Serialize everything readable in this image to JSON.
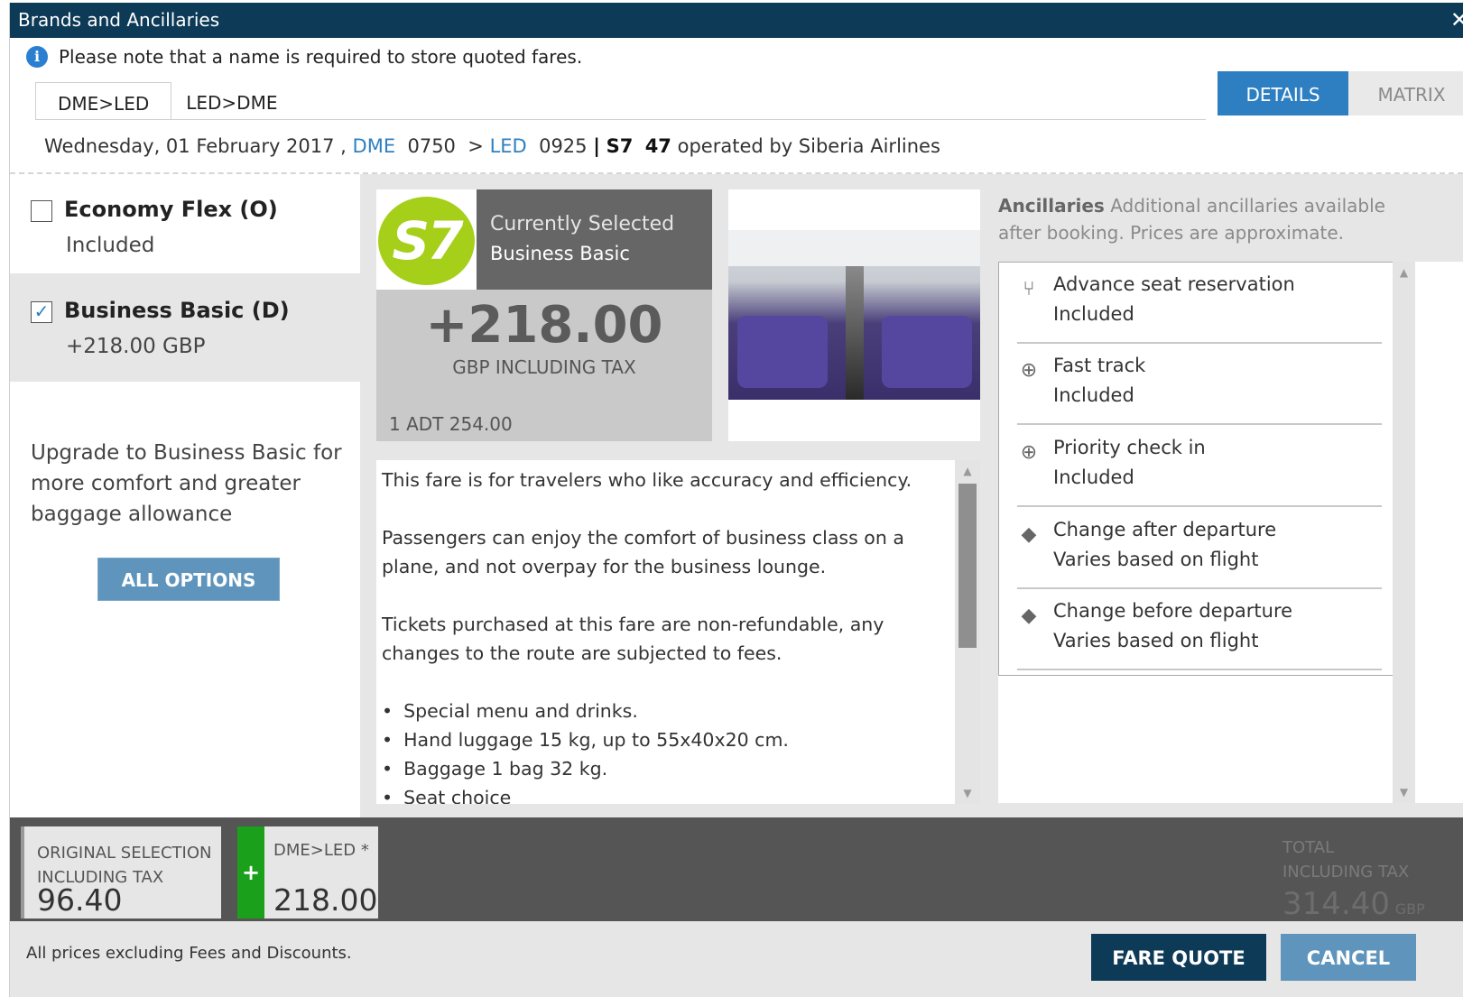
{
  "window": {
    "title": "Brands and Ancillaries",
    "close_glyph": "✕"
  },
  "notice": {
    "icon": "info-icon",
    "text": "Please note that a name is required to store quoted fares."
  },
  "tabs": [
    {
      "label": "DME>LED",
      "active": true
    },
    {
      "label": "LED>DME",
      "active": false
    }
  ],
  "view_switch": {
    "details": "DETAILS",
    "matrix": "MATRIX",
    "active": "DETAILS"
  },
  "flight": {
    "date": "Wednesday, 01 February 2017 ,",
    "origin": "DME",
    "dep_time": "0750",
    "arrow": ">",
    "destination": "LED",
    "arr_time": "0925",
    "separator": "|",
    "carrier": "S7",
    "number": "47",
    "operated_by": "operated by Siberia Airlines"
  },
  "brands": [
    {
      "name": "Economy Flex (O)",
      "price": "Included",
      "checked": false
    },
    {
      "name": "Business Basic (D)",
      "price": "+218.00  GBP",
      "checked": true
    }
  ],
  "upgrade_text": "Upgrade to Business Basic for more comfort and greater baggage allowance",
  "all_options_label": "ALL OPTIONS",
  "selected": {
    "logo_text": "S7",
    "currently_selected": "Currently Selected",
    "brand": "Business Basic",
    "price": "+218.00",
    "price_note": "GBP INCLUDING TAX",
    "adt": "1 ADT 254.00"
  },
  "description": {
    "paragraphs": [
      "This fare is for travelers who like accuracy and efficiency.",
      "Passengers can enjoy the comfort of business class on a plane, and not overpay for the business lounge.",
      "Tickets purchased at this fare are non-refundable, any changes to the route are subjected to fees."
    ],
    "bullets": [
      "Special menu and drinks.",
      "Hand luggage 15 kg, up to 55x40x20 cm.",
      "Baggage 1 bag 32 kg.",
      "Seat choice"
    ]
  },
  "ancillaries": {
    "title": "Ancillaries",
    "subtitle": "Additional ancillaries available after booking. Prices are approximate.",
    "items": [
      {
        "icon": "seat-icon",
        "name": "Advance seat reservation",
        "status": "Included"
      },
      {
        "icon": "globe-icon",
        "name": "Fast track",
        "status": "Included"
      },
      {
        "icon": "globe-icon",
        "name": "Priority check in",
        "status": "Included"
      },
      {
        "icon": "tag-icon",
        "name": "Change after departure",
        "status": "Varies based on flight"
      },
      {
        "icon": "tag-icon",
        "name": "Change before departure",
        "status": "Varies based on flight"
      }
    ]
  },
  "summary": {
    "original_label": "ORIGINAL SELECTION INCLUDING TAX",
    "original_value": "96.40",
    "plus": "+",
    "leg_label": "DME>LED *",
    "leg_value": "218.00",
    "total_label_1": "TOTAL",
    "total_label_2": "INCLUDING TAX",
    "total_value": "314.40",
    "total_currency": "GBP"
  },
  "footer": {
    "note": "All prices excluding Fees and Discounts.",
    "fare_quote": "FARE QUOTE",
    "cancel": "CANCEL"
  },
  "colors": {
    "titlebar": "#0d3a57",
    "accent": "#2e7fc1",
    "s7_green": "#a5cf18",
    "plus_green": "#1aa01a"
  }
}
